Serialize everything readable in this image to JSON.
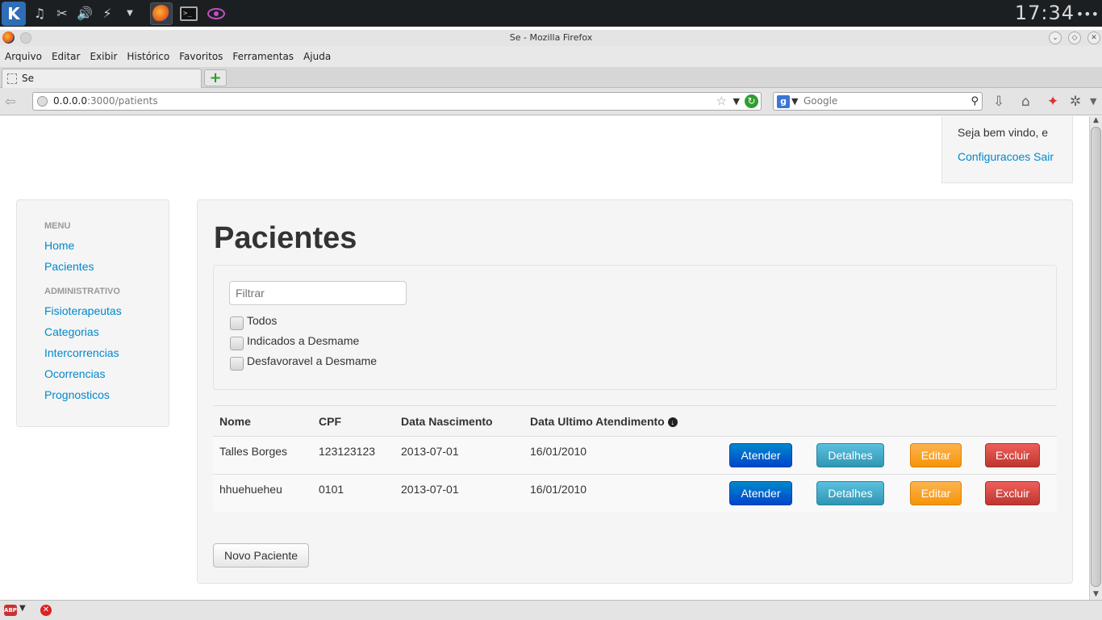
{
  "panel": {
    "clock": "17:34",
    "dots": "•••"
  },
  "window": {
    "title": "Se - Mozilla Firefox"
  },
  "menubar": [
    "Arquivo",
    "Editar",
    "Exibir",
    "Histórico",
    "Favoritos",
    "Ferramentas",
    "Ajuda"
  ],
  "tab": {
    "label": "Se",
    "new_tab": "+"
  },
  "address": {
    "host": "0.0.0.0",
    "path": ":3000/patients"
  },
  "search": {
    "placeholder": "Google",
    "engine_letter": "g"
  },
  "userbox": {
    "welcome": "Seja bem vindo, e",
    "settings": "Configuracoes",
    "logout": "Sair"
  },
  "sidebar": {
    "menu_header": "MENU",
    "menu_items": [
      "Home",
      "Pacientes"
    ],
    "admin_header": "ADMINISTRATIVO",
    "admin_items": [
      "Fisioterapeutas",
      "Categorias",
      "Intercorrencias",
      "Ocorrencias",
      "Prognosticos"
    ]
  },
  "main": {
    "title": "Pacientes",
    "filter_placeholder": "Filtrar",
    "filters": [
      "Todos",
      "Indicados a Desmame",
      "Desfavoravel a Desmame"
    ],
    "columns": [
      "Nome",
      "CPF",
      "Data Nascimento",
      "Data Ultimo Atendimento"
    ],
    "rows": [
      {
        "nome": "Talles Borges",
        "cpf": "123123123",
        "nascimento": "2013-07-01",
        "ultimo": "16/01/2010"
      },
      {
        "nome": "hhuehueheu",
        "cpf": "0101",
        "nascimento": "2013-07-01",
        "ultimo": "16/01/2010"
      }
    ],
    "actions": {
      "atender": "Atender",
      "detalhes": "Detalhes",
      "editar": "Editar",
      "excluir": "Excluir"
    },
    "new_button": "Novo Paciente"
  },
  "colors": {
    "link": "#0088cc",
    "primary": "#0044cc",
    "info": "#2f96b4",
    "warning": "#f89406",
    "danger": "#bd362f"
  },
  "statusbar": {
    "abp": "ABP"
  }
}
